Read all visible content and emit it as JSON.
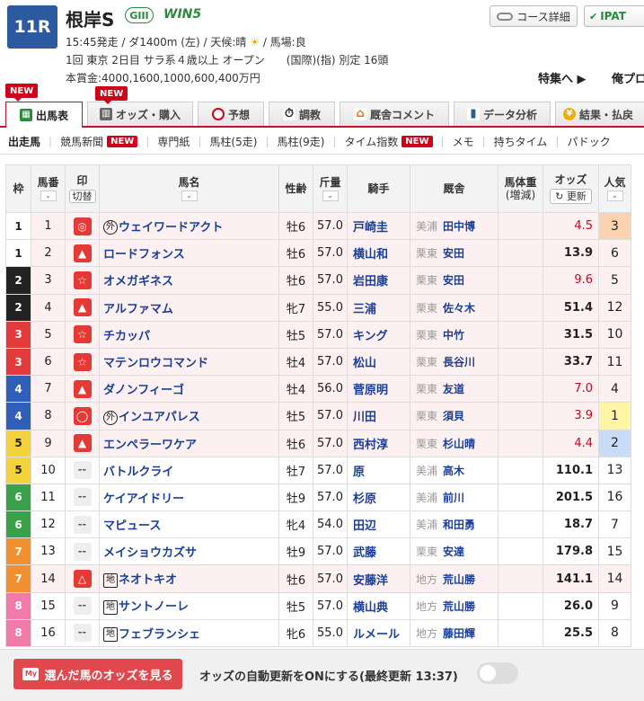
{
  "race": {
    "number": "11R",
    "name": "根岸S",
    "grade": "GIII",
    "win5": "WIN5",
    "line1_pre": "15:45発走 / ダ1400m (左) / 天候:晴",
    "weather_icon": "sun-icon",
    "line1_post": "/ 馬場:良",
    "line2": "1回 東京 2日目 サラ系４歳以上 オープン　　(国際)(指) 別定 16頭",
    "line3": "本賞金:4000,1600,1000,600,400万円"
  },
  "header_buttons": {
    "course": "コース詳細",
    "ipat": "IPAT",
    "feature": "特集へ ▶",
    "mypro": "俺プロ"
  },
  "tabs": [
    {
      "label": "出馬表",
      "new": "NEW",
      "active": true
    },
    {
      "label": "オッズ・購入",
      "new": "NEW",
      "active": false
    },
    {
      "label": "予想",
      "new": "",
      "active": false
    },
    {
      "label": "調教",
      "new": "",
      "active": false
    },
    {
      "label": "厩舎コメント",
      "new": "",
      "active": false
    },
    {
      "label": "データ分析",
      "new": "",
      "active": false
    },
    {
      "label": "結果・払戻",
      "new": "",
      "active": false
    }
  ],
  "subnav": [
    {
      "label": "出走馬",
      "new": ""
    },
    {
      "label": "競馬新聞",
      "new": "NEW"
    },
    {
      "label": "専門紙",
      "new": ""
    },
    {
      "label": "馬柱(5走)",
      "new": ""
    },
    {
      "label": "馬柱(9走)",
      "new": ""
    },
    {
      "label": "タイム指数",
      "new": "NEW"
    },
    {
      "label": "メモ",
      "new": ""
    },
    {
      "label": "持ちタイム",
      "new": ""
    },
    {
      "label": "パドック",
      "new": ""
    }
  ],
  "columns": {
    "waku": "枠",
    "umaban": "馬番",
    "mark": "印",
    "mark_btn": "切替",
    "horse": "馬名",
    "sexage": "性齢",
    "weight": "斤量",
    "jockey": "騎手",
    "trainer": "厩舎",
    "bodyweight": "馬体重",
    "bodyweight_sub": "(増減)",
    "odds": "オッズ",
    "odds_btn": "更新",
    "pop": "人気"
  },
  "rows": [
    {
      "waku": "1",
      "num": "1",
      "mark": "◎",
      "prefix": "外",
      "horse": "ウェイワードアクト",
      "sexage": "牡6",
      "weight": "57.0",
      "jockey": "戸崎圭",
      "area": "美浦",
      "trainer": "田中博",
      "odds": "4.5",
      "pop": "3"
    },
    {
      "waku": "1",
      "num": "2",
      "mark": "▲",
      "prefix": "",
      "horse": "ロードフォンス",
      "sexage": "牡6",
      "weight": "57.0",
      "jockey": "横山和",
      "area": "栗東",
      "trainer": "安田",
      "odds": "13.9",
      "pop": "6"
    },
    {
      "waku": "2",
      "num": "3",
      "mark": "☆",
      "prefix": "",
      "horse": "オメガギネス",
      "sexage": "牡6",
      "weight": "57.0",
      "jockey": "岩田康",
      "area": "栗東",
      "trainer": "安田",
      "odds": "9.6",
      "pop": "5"
    },
    {
      "waku": "2",
      "num": "4",
      "mark": "▲",
      "prefix": "",
      "horse": "アルファマム",
      "sexage": "牝7",
      "weight": "55.0",
      "jockey": "三浦",
      "area": "栗東",
      "trainer": "佐々木",
      "odds": "51.4",
      "pop": "12"
    },
    {
      "waku": "3",
      "num": "5",
      "mark": "☆",
      "prefix": "",
      "horse": "チカッパ",
      "sexage": "牡5",
      "weight": "57.0",
      "jockey": "キング",
      "area": "栗東",
      "trainer": "中竹",
      "odds": "31.5",
      "pop": "10"
    },
    {
      "waku": "3",
      "num": "6",
      "mark": "☆",
      "prefix": "",
      "horse": "マテンロウコマンド",
      "sexage": "牡4",
      "weight": "57.0",
      "jockey": "松山",
      "area": "栗東",
      "trainer": "長谷川",
      "odds": "33.7",
      "pop": "11"
    },
    {
      "waku": "4",
      "num": "7",
      "mark": "▲",
      "prefix": "",
      "horse": "ダノンフィーゴ",
      "sexage": "牡4",
      "weight": "56.0",
      "jockey": "菅原明",
      "area": "栗東",
      "trainer": "友道",
      "odds": "7.0",
      "pop": "4"
    },
    {
      "waku": "4",
      "num": "8",
      "mark": "◯",
      "prefix": "外",
      "horse": "インユアパレス",
      "sexage": "牡5",
      "weight": "57.0",
      "jockey": "川田",
      "area": "栗東",
      "trainer": "須貝",
      "odds": "3.9",
      "pop": "1"
    },
    {
      "waku": "5",
      "num": "9",
      "mark": "▲",
      "prefix": "",
      "horse": "エンペラーワケア",
      "sexage": "牡6",
      "weight": "57.0",
      "jockey": "西村淳",
      "area": "栗東",
      "trainer": "杉山晴",
      "odds": "4.4",
      "pop": "2"
    },
    {
      "waku": "5",
      "num": "10",
      "mark": "--",
      "prefix": "",
      "horse": "バトルクライ",
      "sexage": "牡7",
      "weight": "57.0",
      "jockey": "原",
      "area": "美浦",
      "trainer": "高木",
      "odds": "110.1",
      "pop": "13"
    },
    {
      "waku": "6",
      "num": "11",
      "mark": "--",
      "prefix": "",
      "horse": "ケイアイドリー",
      "sexage": "牡9",
      "weight": "57.0",
      "jockey": "杉原",
      "area": "美浦",
      "trainer": "前川",
      "odds": "201.5",
      "pop": "16"
    },
    {
      "waku": "6",
      "num": "12",
      "mark": "--",
      "prefix": "",
      "horse": "マピュース",
      "sexage": "牝4",
      "weight": "54.0",
      "jockey": "田辺",
      "area": "美浦",
      "trainer": "和田勇",
      "odds": "18.7",
      "pop": "7"
    },
    {
      "waku": "7",
      "num": "13",
      "mark": "--",
      "prefix": "",
      "horse": "メイショウカズサ",
      "sexage": "牡9",
      "weight": "57.0",
      "jockey": "武藤",
      "area": "栗東",
      "trainer": "安達",
      "odds": "179.8",
      "pop": "15"
    },
    {
      "waku": "7",
      "num": "14",
      "mark": "△",
      "prefix": "地",
      "horse": "ネオトキオ",
      "sexage": "牡6",
      "weight": "57.0",
      "jockey": "安藤洋",
      "area": "地方",
      "trainer": "荒山勝",
      "odds": "141.1",
      "pop": "14"
    },
    {
      "waku": "8",
      "num": "15",
      "mark": "--",
      "prefix": "地",
      "horse": "サントノーレ",
      "sexage": "牡5",
      "weight": "57.0",
      "jockey": "横山典",
      "area": "地方",
      "trainer": "荒山勝",
      "odds": "26.0",
      "pop": "9"
    },
    {
      "waku": "8",
      "num": "16",
      "mark": "--",
      "prefix": "地",
      "horse": "フェブランシェ",
      "sexage": "牝6",
      "weight": "55.0",
      "jockey": "ルメール",
      "area": "地方",
      "trainer": "藤田輝",
      "odds": "25.5",
      "pop": "8"
    }
  ],
  "footer": {
    "odds_button": "選んだ馬のオッズを見る",
    "odds_button_icon": "My",
    "auto_update": "オッズの自動更新をONにする(最終更新 13:37)",
    "auto_update_on": false
  },
  "colors": {
    "accent": "#c8102e",
    "mark_red": "#e53935",
    "link_blue": "#1a3f9a",
    "waku": {
      "1": {
        "bg": "#ffffff",
        "fg": "#222222"
      },
      "2": {
        "bg": "#222222",
        "fg": "#ffffff"
      },
      "3": {
        "bg": "#e33b3b",
        "fg": "#ffffff"
      },
      "4": {
        "bg": "#2f5fb8",
        "fg": "#ffffff"
      },
      "5": {
        "bg": "#f3d23c",
        "fg": "#222222"
      },
      "6": {
        "bg": "#3aa04a",
        "fg": "#ffffff"
      },
      "7": {
        "bg": "#f09030",
        "fg": "#ffffff"
      },
      "8": {
        "bg": "#f07aa8",
        "fg": "#ffffff"
      }
    }
  }
}
